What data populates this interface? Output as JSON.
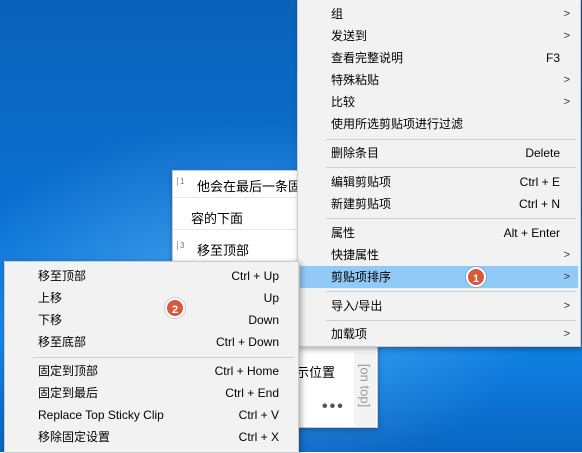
{
  "clip_window": {
    "rows": [
      {
        "num": "1",
        "text": "他会在最后一条固"
      },
      {
        "num": "",
        "text": "容的下面"
      },
      {
        "num": "3",
        "text": "移至顶部"
      }
    ],
    "partial_text": "示位置",
    "more_label": "•••",
    "on_top_label": "[on top]"
  },
  "main_menu": {
    "items": [
      {
        "label": "组",
        "shortcut": "",
        "submenu": true
      },
      {
        "label": "发送到",
        "shortcut": "",
        "submenu": true
      },
      {
        "label": "查看完整说明",
        "shortcut": "F3",
        "submenu": false
      },
      {
        "label": "特殊粘贴",
        "shortcut": "",
        "submenu": true
      },
      {
        "label": "比较",
        "shortcut": "",
        "submenu": true
      },
      {
        "label": "使用所选剪贴项进行过滤",
        "shortcut": "",
        "submenu": false
      },
      {
        "label": "删除条目",
        "shortcut": "Delete",
        "submenu": false
      },
      {
        "label": "编辑剪贴项",
        "shortcut": "Ctrl + E",
        "submenu": false
      },
      {
        "label": "新建剪贴项",
        "shortcut": "Ctrl + N",
        "submenu": false
      },
      {
        "label": "属性",
        "shortcut": "Alt + Enter",
        "submenu": false
      },
      {
        "label": "快捷属性",
        "shortcut": "",
        "submenu": true
      },
      {
        "label": "剪贴项排序",
        "shortcut": "",
        "submenu": true
      },
      {
        "label": "导入/导出",
        "shortcut": "",
        "submenu": true
      },
      {
        "label": "加载项",
        "shortcut": "",
        "submenu": true
      }
    ]
  },
  "sub_menu": {
    "items": [
      {
        "label": "移至顶部",
        "shortcut": "Ctrl + Up"
      },
      {
        "label": "上移",
        "shortcut": "Up"
      },
      {
        "label": "下移",
        "shortcut": "Down"
      },
      {
        "label": "移至底部",
        "shortcut": "Ctrl + Down"
      },
      {
        "label": "固定到顶部",
        "shortcut": "Ctrl + Home"
      },
      {
        "label": "固定到最后",
        "shortcut": "Ctrl + End"
      },
      {
        "label": "Replace Top Sticky Clip",
        "shortcut": "Ctrl + V"
      },
      {
        "label": "移除固定设置",
        "shortcut": "Ctrl + X"
      }
    ]
  },
  "badges": {
    "first": "1",
    "second": "2"
  },
  "colors": {
    "highlight": "#91c9f7",
    "badge": "#d9573a",
    "desktop": "#0b6fd0"
  },
  "icons": {
    "submenu_arrow": "chevron-right-icon"
  }
}
